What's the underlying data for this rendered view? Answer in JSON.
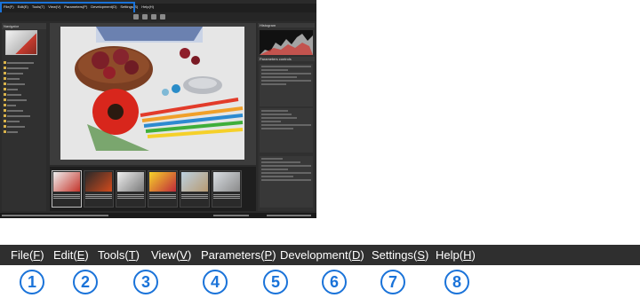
{
  "screenshot": {
    "menubar_items": [
      {
        "label": "File(",
        "key": "F",
        "tail": ")"
      },
      {
        "label": "Edit(",
        "key": "E",
        "tail": ")"
      },
      {
        "label": "Tools(",
        "key": "T",
        "tail": ")"
      },
      {
        "label": "View(",
        "key": "V",
        "tail": ")"
      },
      {
        "label": "Parameters(",
        "key": "P",
        "tail": ")"
      },
      {
        "label": "Development(",
        "key": "D",
        "tail": ")"
      },
      {
        "label": "Settings(",
        "key": "S",
        "tail": ")"
      },
      {
        "label": "Help(",
        "key": "H",
        "tail": ")"
      }
    ],
    "navigator_title": "Navigator",
    "histogram_title": "Histogram",
    "parameters_title": "Parameters controls",
    "colors": {
      "highlight": "#1a73d9",
      "menubar_bg": "#2f2f2f",
      "app_bg": "#2b2b2b"
    }
  },
  "menubar": {
    "items": [
      {
        "label": "File(",
        "key": "F",
        "tail": ")"
      },
      {
        "label": "Edit(",
        "key": "E",
        "tail": ")"
      },
      {
        "label": "Tools(",
        "key": "T",
        "tail": ")"
      },
      {
        "label": "View(",
        "key": "V",
        "tail": ")"
      },
      {
        "label": "Parameters(",
        "key": "P",
        "tail": ")"
      },
      {
        "label": "Development(",
        "key": "D",
        "tail": ")"
      },
      {
        "label": "Settings(",
        "key": "S",
        "tail": ")"
      },
      {
        "label": "Help(",
        "key": "H",
        "tail": ")"
      }
    ]
  },
  "callouts": [
    "1",
    "2",
    "3",
    "4",
    "5",
    "6",
    "7",
    "8"
  ]
}
